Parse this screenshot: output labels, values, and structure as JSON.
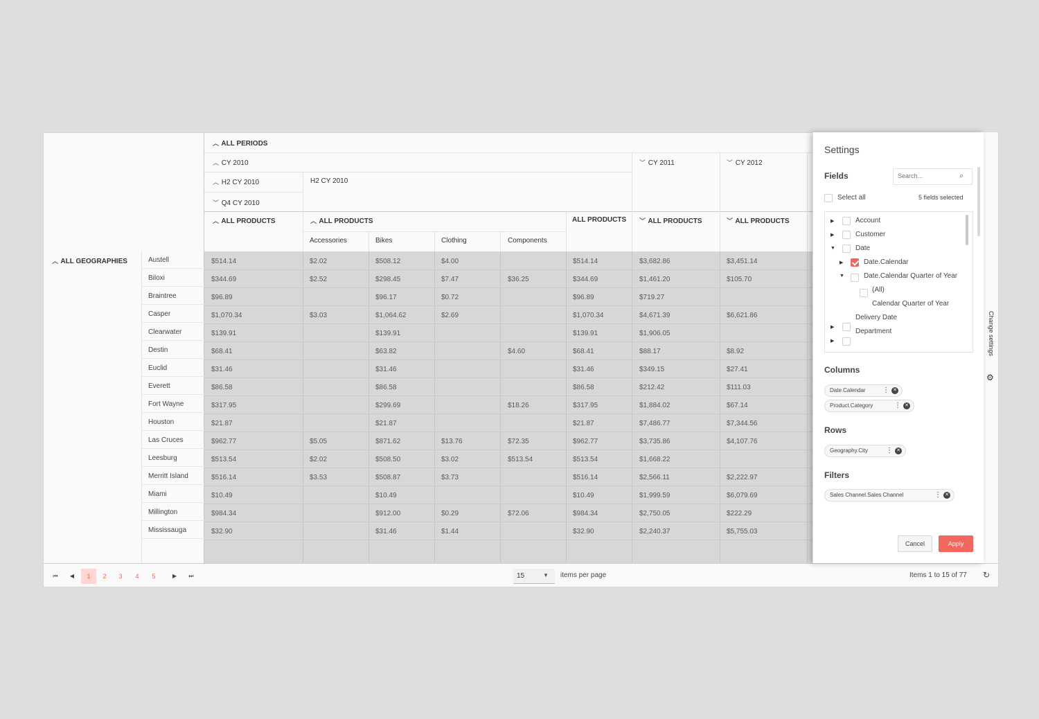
{
  "columns": {
    "all_periods": "ALL PERIODS",
    "cy2010": "CY 2010",
    "cy2011": "CY 2011",
    "cy2012": "CY 2012",
    "h2cy2010": "H2 CY 2010",
    "h2cy2010_label": "H2 CY 2010",
    "q4cy2010": "Q4 CY 2010",
    "all_products": "ALL PRODUCTS",
    "accessories": "Accessories",
    "bikes": "Bikes",
    "clothing": "Clothing",
    "components": "Components"
  },
  "rows": {
    "all_geographies": "ALL GEOGRAPHIES",
    "cities": [
      "Austell",
      "Biloxi",
      "Braintree",
      "Casper",
      "Clearwater",
      "Destin",
      "Euclid",
      "Everett",
      "Fort Wayne",
      "Houston",
      "Las Cruces",
      "Leesburg",
      "Merritt Island",
      "Miami",
      "Millington",
      "Mississauga"
    ]
  },
  "data": [
    [
      "$514.14",
      "$2.02",
      "$508.12",
      "$4.00",
      "",
      "$514.14",
      "$3,682.86",
      "$3,451.14"
    ],
    [
      "$344.69",
      "$2.52",
      "$298.45",
      "$7.47",
      "$36.25",
      "$344.69",
      "$1,461.20",
      "$105.70"
    ],
    [
      "$96.89",
      "",
      "$96.17",
      "$0.72",
      "",
      "$96.89",
      "$719.27",
      ""
    ],
    [
      "$1,070.34",
      "$3.03",
      "$1,064.62",
      "$2.69",
      "",
      "$1,070.34",
      "$4,671.39",
      "$6,621.86"
    ],
    [
      "$139.91",
      "",
      "$139.91",
      "",
      "",
      "$139.91",
      "$1,906.05",
      ""
    ],
    [
      "$68.41",
      "",
      "$63.82",
      "",
      "$4.60",
      "$68.41",
      "$88.17",
      "$8.92"
    ],
    [
      "$31.46",
      "",
      "$31.46",
      "",
      "",
      "$31.46",
      "$349.15",
      "$27.41"
    ],
    [
      "$86.58",
      "",
      "$86.58",
      "",
      "",
      "$86.58",
      "$212.42",
      "$111.03"
    ],
    [
      "$317.95",
      "",
      "$299.69",
      "",
      "$18.26",
      "$317.95",
      "$1,884.02",
      "$67.14"
    ],
    [
      "$21.87",
      "",
      "$21.87",
      "",
      "",
      "$21.87",
      "$7,486.77",
      "$7,344.56"
    ],
    [
      "$962.77",
      "$5.05",
      "$871.62",
      "$13.76",
      "$72.35",
      "$962.77",
      "$3,735.86",
      "$4,107.76"
    ],
    [
      "$513.54",
      "$2.02",
      "$508.50",
      "$3.02",
      "$513.54",
      "$513.54",
      "$1,668.22",
      ""
    ],
    [
      "$516.14",
      "$3.53",
      "$508.87",
      "$3.73",
      "",
      "$516.14",
      "$2,566.11",
      "$2,222.97"
    ],
    [
      "$10.49",
      "",
      "$10.49",
      "",
      "",
      "$10.49",
      "$1,999.59",
      "$6,079.69"
    ],
    [
      "$984.34",
      "",
      "$912.00",
      "$0.29",
      "$72.06",
      "$984.34",
      "$2,750.05",
      "$222.29"
    ],
    [
      "$32.90",
      "",
      "$31.46",
      "$1.44",
      "",
      "$32.90",
      "$2,240.37",
      "$5,755.03"
    ]
  ],
  "pager": {
    "pages": [
      "1",
      "2",
      "3",
      "4",
      "5"
    ],
    "page_size": "15",
    "items_per_page": "items per page",
    "info": "Items 1 to 15 of 77"
  },
  "settings": {
    "title": "Settings",
    "fields": "Fields",
    "search_placeholder": "Search...",
    "select_all": "Select all",
    "fields_selected": "5 fields selected",
    "tree": [
      "Account",
      "Customer",
      "Date",
      "Date.Calendar",
      "Date.Calendar Quarter of Year",
      "(All)",
      "Calendar Quarter of Year",
      "Delivery Date",
      "Department"
    ],
    "columns": "Columns",
    "column_chips": [
      "Date.Calendar",
      "Product.Category"
    ],
    "rows": "Rows",
    "row_chips": [
      "Geography.City"
    ],
    "filters": "Filters",
    "filter_chips": [
      "Sales Channel.Sales Channel"
    ],
    "cancel": "Cancel",
    "apply": "Apply",
    "change_settings": "Change settings"
  },
  "colors": {
    "accent": "#f2665a",
    "pager_active": "#ffd6d2"
  }
}
